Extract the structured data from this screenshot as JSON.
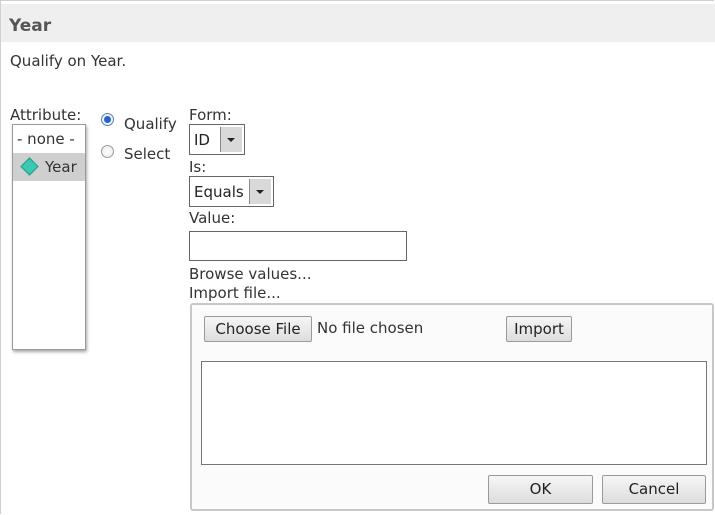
{
  "dialog": {
    "title": "Year",
    "subtitle": "Qualify on Year."
  },
  "attribute": {
    "label": "Attribute:",
    "items": [
      {
        "label": "- none -",
        "selected": false
      },
      {
        "label": "Year",
        "selected": true,
        "icon": "attribute-diamond-icon",
        "icon_color": "#3cc7b2"
      }
    ]
  },
  "mode": {
    "qualify_label": "Qualify",
    "select_label": "Select",
    "selected": "Qualify"
  },
  "form": {
    "label": "Form:",
    "value": "ID"
  },
  "operator": {
    "label": "Is:",
    "value": "Equals"
  },
  "value_field": {
    "label": "Value:",
    "value": ""
  },
  "links": {
    "browse": "Browse values...",
    "import": "Import file..."
  },
  "import_panel": {
    "choose_file_label": "Choose File",
    "no_file_text": "No file chosen",
    "import_label": "Import",
    "textarea_value": "",
    "ok_label": "OK",
    "cancel_label": "Cancel"
  },
  "colors": {
    "title_bar": "#efefef",
    "selected_item": "#cfcfcf",
    "radio_checked": "#2266cc"
  }
}
